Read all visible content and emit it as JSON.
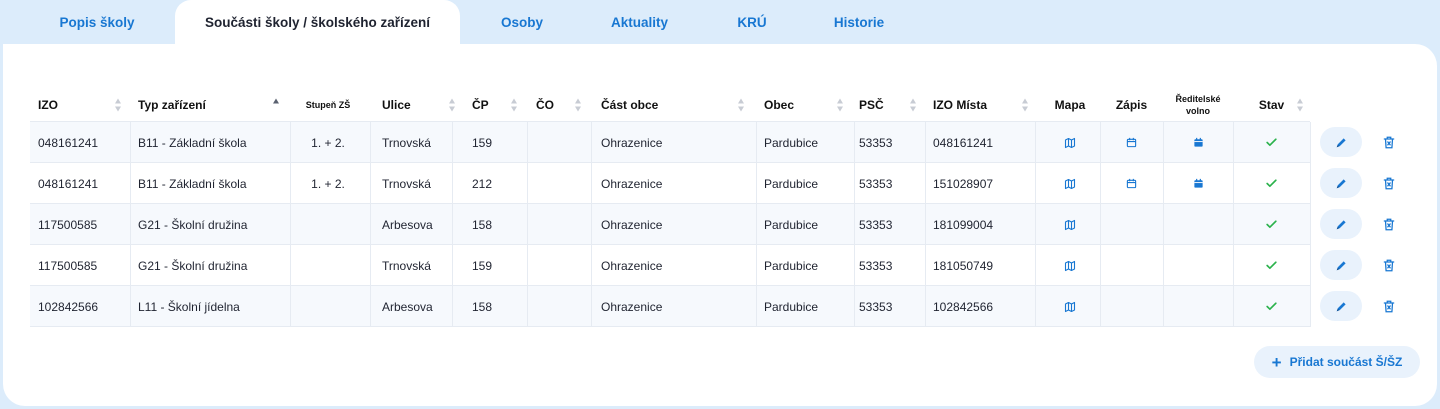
{
  "tabs": [
    {
      "label": "Popis školy"
    },
    {
      "label": "Součásti školy / školského zařízení"
    },
    {
      "label": "Osoby"
    },
    {
      "label": "Aktuality"
    },
    {
      "label": "KRÚ"
    },
    {
      "label": "Historie"
    }
  ],
  "table": {
    "headers": {
      "izo": "IZO",
      "typ": "Typ zařízení",
      "stupen": "Stupeň ZŠ",
      "ulice": "Ulice",
      "cp": "ČP",
      "co": "ČO",
      "cast_obce": "Část obce",
      "obec": "Obec",
      "psc": "PSČ",
      "izo_mista": "IZO Místa",
      "mapa": "Mapa",
      "zapis": "Zápis",
      "reditelske_line1": "Ředitelské",
      "reditelske_line2": "volno",
      "stav": "Stav"
    },
    "rows": [
      {
        "izo": "048161241",
        "typ": "B11 - Základní škola",
        "stupen": "1. + 2.",
        "ulice": "Trnovská",
        "cp": "159",
        "co": "",
        "cast_obce": "Ohrazenice",
        "obec": "Pardubice",
        "psc": "53353",
        "izo_mista": "048161241"
      },
      {
        "izo": "048161241",
        "typ": "B11 - Základní škola",
        "stupen": "1. + 2.",
        "ulice": "Trnovská",
        "cp": "212",
        "co": "",
        "cast_obce": "Ohrazenice",
        "obec": "Pardubice",
        "psc": "53353",
        "izo_mista": "151028907"
      },
      {
        "izo": "117500585",
        "typ": "G21 - Školní družina",
        "stupen": "",
        "ulice": "Arbesova",
        "cp": "158",
        "co": "",
        "cast_obce": "Ohrazenice",
        "obec": "Pardubice",
        "psc": "53353",
        "izo_mista": "181099004"
      },
      {
        "izo": "117500585",
        "typ": "G21 - Školní družina",
        "stupen": "",
        "ulice": "Trnovská",
        "cp": "159",
        "co": "",
        "cast_obce": "Ohrazenice",
        "obec": "Pardubice",
        "psc": "53353",
        "izo_mista": "181050749"
      },
      {
        "izo": "102842566",
        "typ": "L11 - Školní jídelna",
        "stupen": "",
        "ulice": "Arbesova",
        "cp": "158",
        "co": "",
        "cast_obce": "Ohrazenice",
        "obec": "Pardubice",
        "psc": "53353",
        "izo_mista": "102842566"
      }
    ]
  },
  "add_button": {
    "label": "Přidat součást Š/ŠZ",
    "icon": "plus-icon"
  },
  "colors": {
    "accent": "#1877d2",
    "background": "#dcecfb",
    "success": "#2bb24c",
    "button_bg": "#e9f2fc"
  }
}
